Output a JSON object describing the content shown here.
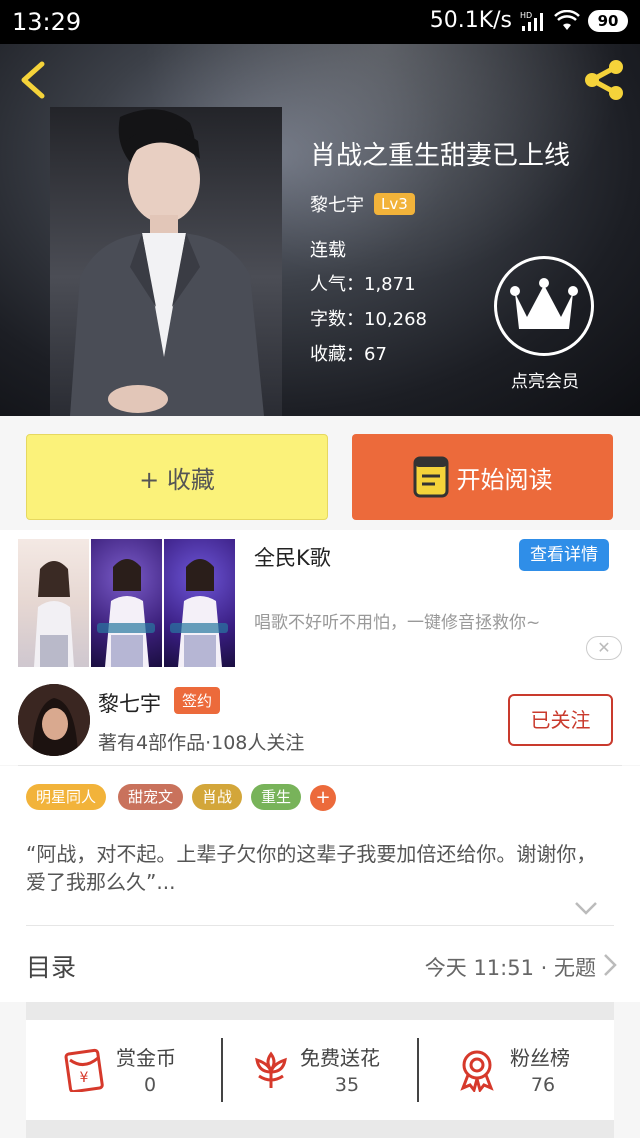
{
  "status_bar": {
    "time": "13:29",
    "network_speed": "50.1K/s",
    "battery": "90"
  },
  "hero": {
    "book_title": "肖战之重生甜妻已上线",
    "author": "黎七宇",
    "level_badge": "Lv3",
    "status": "连载",
    "popularity": "人气：1,871",
    "word_count": "字数：10,268",
    "favorites": "收藏：67",
    "vip_label": "点亮会员"
  },
  "actions": {
    "collect_label": "+ 收藏",
    "read_label": "开始阅读"
  },
  "ad": {
    "title": "全民K歌",
    "detail_button": "查看详情",
    "description": "唱歌不好听不用怕，一键修音拯救你~",
    "close": "✕"
  },
  "author_card": {
    "name": "黎七宇",
    "sign_badge": "签约",
    "stats": "著有4部作品·108人关注",
    "follow_button": "已关注"
  },
  "tags": [
    {
      "label": "明星同人",
      "color": "#f2b33a"
    },
    {
      "label": "甜宠文",
      "color": "#c9725c"
    },
    {
      "label": "肖战",
      "color": "#d3a63a"
    },
    {
      "label": "重生",
      "color": "#78b35a"
    }
  ],
  "tag_add": "+",
  "synopsis": "“阿战，对不起。上辈子欠你的这辈子我要加倍还给你。谢谢你，爱了我那么久”...",
  "catalog": {
    "title": "目录",
    "latest": "今天 11:51 · 无题"
  },
  "stats": [
    {
      "label": "赏金币",
      "value": "0",
      "icon": "red-envelope-icon"
    },
    {
      "label": "免费送花",
      "value": "35",
      "icon": "flower-icon"
    },
    {
      "label": "粉丝榜",
      "value": "76",
      "icon": "medal-icon"
    }
  ],
  "colors": {
    "accent_orange": "#ec6a3b",
    "collect_yellow": "#fbf27a",
    "follow_red": "#c93a2d",
    "ad_blue": "#2f8ee8",
    "icon_red": "#d6392b"
  }
}
